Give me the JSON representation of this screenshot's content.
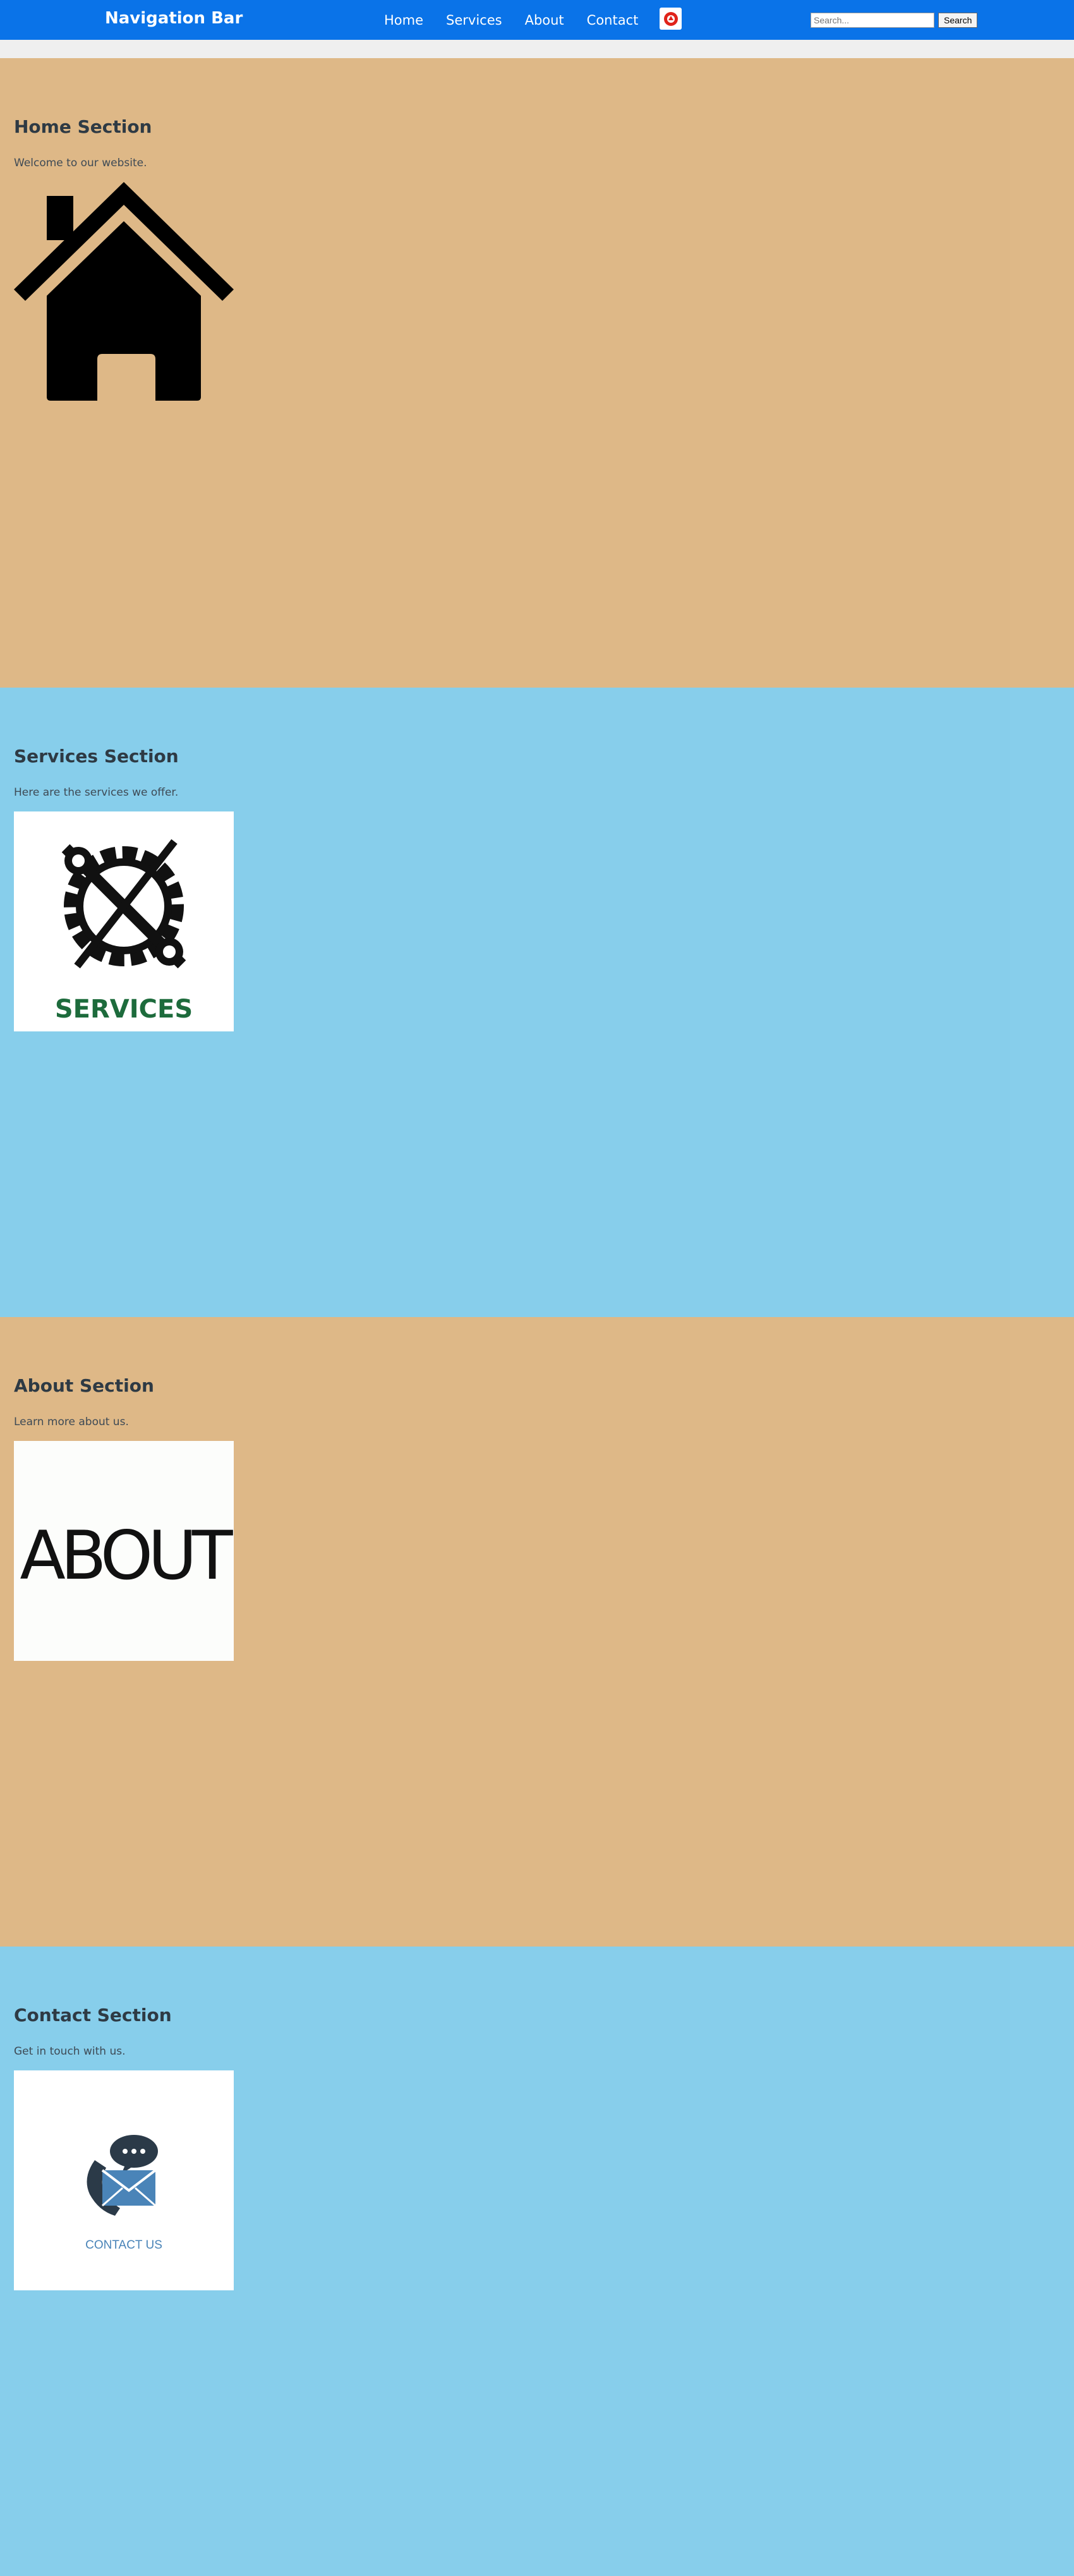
{
  "navbar": {
    "brand": "Navigation Bar",
    "links": [
      "Home",
      "Services",
      "About",
      "Contact"
    ],
    "logo_icon": "red-circle-logo-icon",
    "search": {
      "placeholder": "Search...",
      "button": "Search"
    }
  },
  "sections": [
    {
      "id": "home",
      "title": "Home Section",
      "text": "Welcome to our website.",
      "image_icon": "house-icon",
      "bg": "#deb887"
    },
    {
      "id": "services",
      "title": "Services Section",
      "text": "Here are the services we offer.",
      "image_icon": "wrench-screwdriver-gear-icon",
      "image_caption": "SERVICES",
      "bg": "#87ceeb"
    },
    {
      "id": "about",
      "title": "About Section",
      "text": "Learn more about us.",
      "image_caption": "ABOUT",
      "bg": "#deb887"
    },
    {
      "id": "contact",
      "title": "Contact Section",
      "text": "Get in touch with us.",
      "image_icon": "phone-envelope-chat-icon",
      "image_caption": "CONTACT US",
      "bg": "#87ceeb"
    }
  ],
  "colors": {
    "navbar": "#0a73e8",
    "tan": "#deb887",
    "sky": "#87ceeb",
    "services_green": "#1d6b3c",
    "contact_blue": "#4a84b8"
  }
}
